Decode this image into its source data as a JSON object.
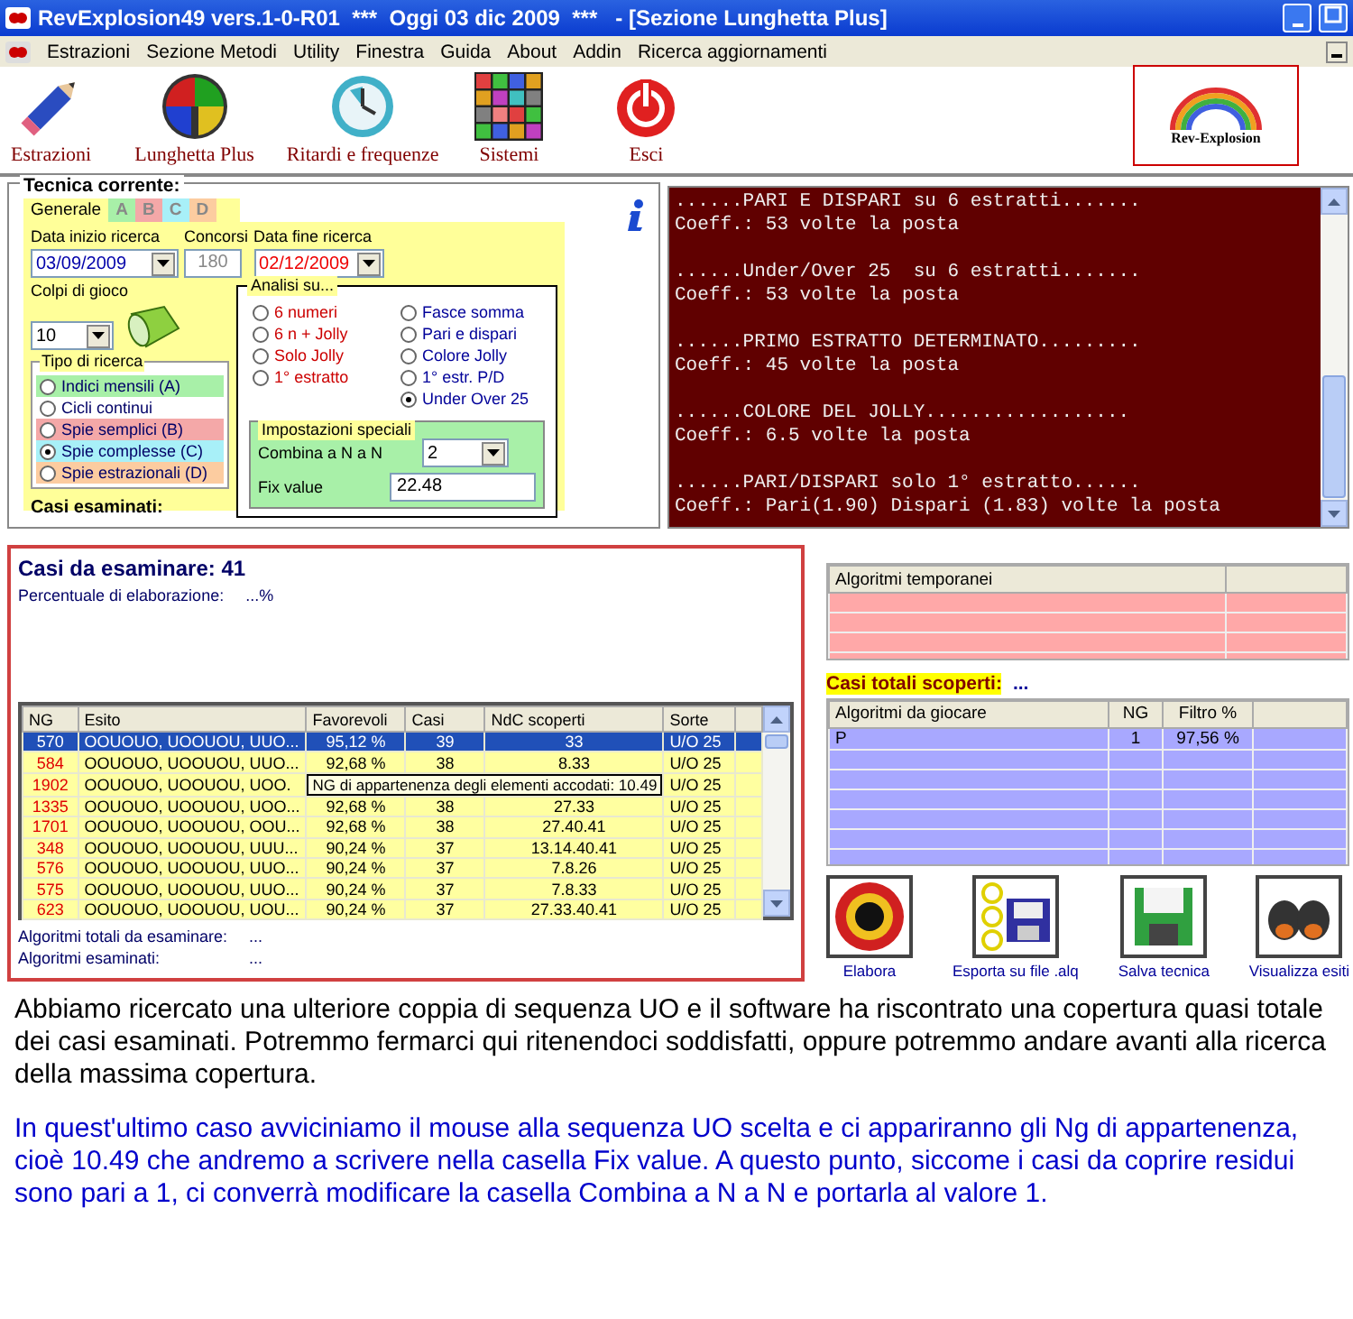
{
  "window": {
    "title": "RevExplosion49 vers.1-0-R01  ***  Oggi 03 dic 2009  ***   - [Sezione Lunghetta Plus]"
  },
  "menu": [
    "Estrazioni",
    "Sezione Metodi",
    "Utility",
    "Finestra",
    "Guida",
    "About",
    "Addin",
    "Ricerca aggiornamenti"
  ],
  "toolbar": [
    {
      "label": "Estrazioni",
      "kind": "pencil"
    },
    {
      "label": "Lunghetta Plus",
      "kind": "quadrants"
    },
    {
      "label": "Ritardi e frequenze",
      "kind": "clock"
    },
    {
      "label": "Sistemi",
      "kind": "grid"
    },
    {
      "label": "Esci",
      "kind": "power"
    }
  ],
  "logo": {
    "title": "Rev-Explosion"
  },
  "tecnica": {
    "title": "Tecnica corrente:",
    "tabs": [
      {
        "label": "Generale",
        "selected": true,
        "color": "#ffff99"
      },
      {
        "label": "A",
        "selected": false,
        "color": "#a8f0a8"
      },
      {
        "label": "B",
        "selected": false,
        "color": "#f4a8a8"
      },
      {
        "label": "C",
        "selected": false,
        "color": "#a8f0f8"
      },
      {
        "label": "D",
        "selected": false,
        "color": "#fccca0"
      }
    ],
    "data_inizio": {
      "label": "Data inizio ricerca",
      "value": "03/09/2009"
    },
    "concorsi": {
      "label": "Concorsi",
      "value": "180",
      "disabled": true
    },
    "data_fine": {
      "label": "Data fine ricerca",
      "value": "02/12/2009"
    },
    "colpi": {
      "label": "Colpi di gioco",
      "value": "10"
    },
    "tipo": {
      "title": "Tipo di ricerca",
      "options": [
        {
          "label": "Indici mensili (A)",
          "selected": false,
          "color": "#a8f0a8"
        },
        {
          "label": "Cicli continui",
          "selected": false,
          "color": "#ffffff"
        },
        {
          "label": "Spie semplici (B)",
          "selected": false,
          "color": "#f4a8a8"
        },
        {
          "label": "Spie complesse (C)",
          "selected": true,
          "color": "#a8f0f8"
        },
        {
          "label": "Spie estrazionali (D)",
          "selected": false,
          "color": "#fccca0"
        }
      ]
    },
    "analisi": {
      "title": "Analisi su...",
      "options": [
        {
          "label": "6 numeri",
          "selected": false,
          "color": "#cc0000"
        },
        {
          "label": "Fasce somma",
          "selected": false,
          "color": "#000099"
        },
        {
          "label": "6 n + Jolly",
          "selected": false,
          "color": "#cc0000"
        },
        {
          "label": "Pari e dispari",
          "selected": false,
          "color": "#000099"
        },
        {
          "label": "Solo Jolly",
          "selected": false,
          "color": "#cc0000"
        },
        {
          "label": "Colore Jolly",
          "selected": false,
          "color": "#000099"
        },
        {
          "label": "1° estratto",
          "selected": false,
          "color": "#cc0000"
        },
        {
          "label": "1° estr. P/D",
          "selected": false,
          "color": "#000099"
        },
        {
          "label": "Under Over 25",
          "selected": true,
          "color": "#000099"
        }
      ]
    },
    "impostazioni": {
      "title": "Impostazioni speciali",
      "combina": {
        "label": "Combina a N a N",
        "value": "2"
      },
      "fix": {
        "label": "Fix value",
        "value": "22.48"
      }
    },
    "casi_esaminati": "Casi esaminati:"
  },
  "output": {
    "entries": [
      {
        "title": "......PARI E DISPARI su 6 estratti.......",
        "coeff": "Coeff.: 53 volte la posta"
      },
      {
        "title": "......Under/Over 25  su 6 estratti.......",
        "coeff": "Coeff.: 53 volte la posta"
      },
      {
        "title": "......PRIMO ESTRATTO DETERMINATO.........",
        "coeff": "Coeff.: 45 volte la posta"
      },
      {
        "title": "......COLORE DEL JOLLY..................",
        "coeff": "Coeff.: 6.5 volte la posta"
      },
      {
        "title": "......PARI/DISPARI solo 1° estratto......",
        "coeff": "Coeff.: Pari(1.90) Dispari (1.83) volte la posta"
      }
    ]
  },
  "casi": {
    "title": "Casi da esaminare: 41",
    "percent_label": "Percentuale di elaborazione:",
    "percent_value": "...%",
    "columns": [
      "NG",
      "Esito",
      "Favorevoli",
      "Casi",
      "NdC scoperti",
      "Sorte"
    ],
    "rows": [
      {
        "ng": "570",
        "esito": "OOUOUO, UOOUOU, UUO...",
        "favorevoli": "95,12 %",
        "casi": "39",
        "ndc": "33",
        "sorte": "U/O 25",
        "selected": true
      },
      {
        "ng": "584",
        "esito": "OOUOUO, UOOUOU, UUO...",
        "favorevoli": "92,68 %",
        "casi": "38",
        "ndc": "8.33",
        "sorte": "U/O 25",
        "selected": false
      },
      {
        "ng": "1902",
        "esito": "OOUOUO, UOOUOU, UOO.",
        "tooltip": "NG di appartenenza degli elementi accodati: 10.49",
        "sorte": "U/O 25",
        "selected": false
      },
      {
        "ng": "1335",
        "esito": "OOUOUO, UOOUOU, UOO...",
        "favorevoli": "92,68 %",
        "casi": "38",
        "ndc": "27.33",
        "sorte": "U/O 25",
        "selected": false
      },
      {
        "ng": "1701",
        "esito": "OOUOUO, UOOUOU, OOU...",
        "favorevoli": "92,68 %",
        "casi": "38",
        "ndc": "27.40.41",
        "sorte": "U/O 25",
        "selected": false
      },
      {
        "ng": "348",
        "esito": "OOUOUO, UOOUOU, UUU...",
        "favorevoli": "90,24 %",
        "casi": "37",
        "ndc": "13.14.40.41",
        "sorte": "U/O 25",
        "selected": false
      },
      {
        "ng": "576",
        "esito": "OOUOUO, UOOUOU, UUO...",
        "favorevoli": "90,24 %",
        "casi": "37",
        "ndc": "7.8.26",
        "sorte": "U/O 25",
        "selected": false
      },
      {
        "ng": "575",
        "esito": "OOUOUO, UOOUOU, UUO...",
        "favorevoli": "90,24 %",
        "casi": "37",
        "ndc": "7.8.33",
        "sorte": "U/O 25",
        "selected": false
      },
      {
        "ng": "623",
        "esito": "OOUOUO, UOOUOU, UOU...",
        "favorevoli": "90,24 %",
        "casi": "37",
        "ndc": "27.33.40.41",
        "sorte": "U/O 25",
        "selected": false
      }
    ],
    "totali": {
      "label": "Algoritmi totali da esaminare:",
      "value": "..."
    },
    "esaminati": {
      "label": "Algoritmi esaminati:",
      "value": "..."
    }
  },
  "temporanei": {
    "columns": [
      "Algoritmi temporanei"
    ]
  },
  "casi_totali": {
    "label": "Casi totali scoperti:",
    "value": "..."
  },
  "da_giocare": {
    "columns": [
      "Algoritmi da giocare",
      "NG",
      "Filtro %"
    ],
    "rows": [
      {
        "name": "P",
        "ng": "1",
        "filtro": "97,56 %"
      }
    ]
  },
  "actions": [
    {
      "label": "Elabora",
      "kind": "target"
    },
    {
      "label": "Esporta su file .alq",
      "kind": "export"
    },
    {
      "label": "Salva tecnica",
      "kind": "floppy"
    },
    {
      "label": "Visualizza esiti",
      "kind": "binoculars"
    }
  ],
  "notes": [
    {
      "text": "Abbiamo ricercato una ulteriore coppia di sequenza UO e il software ha riscontrato  una copertura quasi totale dei casi esaminati. Potremmo fermarci qui ritenendoci soddisfatti, oppure potremmo andare avanti alla ricerca della massima copertura.",
      "color": "#000000"
    },
    {
      "text": "In quest'ultimo caso avviciniamo il mouse alla sequenza UO scelta e ci appariranno gli Ng di appartenenza, cioè 10.49  che andremo a scrivere nella casella Fix value. A questo punto, siccome i casi da coprire residui sono pari a 1, ci converrà modificare la casella Combina a N a N e portarla al valore 1.",
      "color": "#0000cc"
    }
  ]
}
